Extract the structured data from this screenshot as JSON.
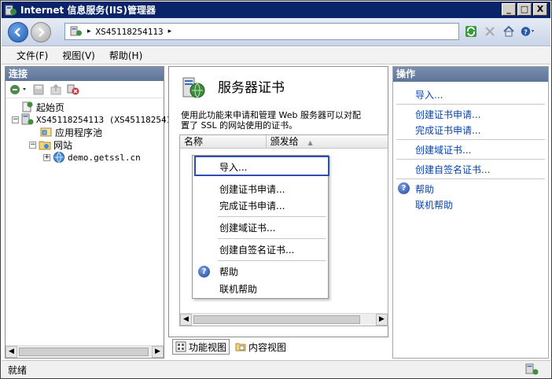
{
  "window": {
    "title": "Internet 信息服务(IIS)管理器",
    "buttons": {
      "minimize": "_",
      "maximize": "□",
      "close": "X"
    }
  },
  "navbar": {
    "address_path": "XS45118254113",
    "address_sep": "▸",
    "address_end": "▸"
  },
  "menubar": {
    "items": [
      "文件(F)",
      "视图(V)",
      "帮助(H)"
    ]
  },
  "connections": {
    "header": "连接",
    "tree": {
      "start_page": "起始页",
      "server": "XS45118254113 (XS451182541",
      "app_pools": "应用程序池",
      "sites": "网站",
      "site_demo": "demo.getssl.cn"
    }
  },
  "center": {
    "title": "服务器证书",
    "description_line1": "使用此功能来申请和管理 Web 服务器可以对配",
    "description_line2": "置了 SSL 的网站使用的证书。",
    "columns": [
      "名称",
      "颁发给"
    ],
    "sort_indicator": "▲"
  },
  "context_menu": {
    "items": [
      "导入...",
      "创建证书申请...",
      "完成证书申请...",
      "创建域证书...",
      "创建自签名证书...",
      "帮助",
      "联机帮助"
    ]
  },
  "view_tabs": {
    "features": "功能视图",
    "content": "内容视图"
  },
  "actions": {
    "header": "操作",
    "links": {
      "import": "导入...",
      "create_request": "创建证书申请...",
      "complete_request": "完成证书申请...",
      "create_domain": "创建域证书...",
      "create_self_signed": "创建自签名证书...",
      "help": "帮助",
      "online_help": "联机帮助"
    }
  },
  "status": {
    "text": "就绪"
  },
  "colors": {
    "titlebar": "#0a246a",
    "panel_header": "#6a7fa2",
    "link": "#0645b4",
    "highlight_border": "#2d4fb3"
  }
}
